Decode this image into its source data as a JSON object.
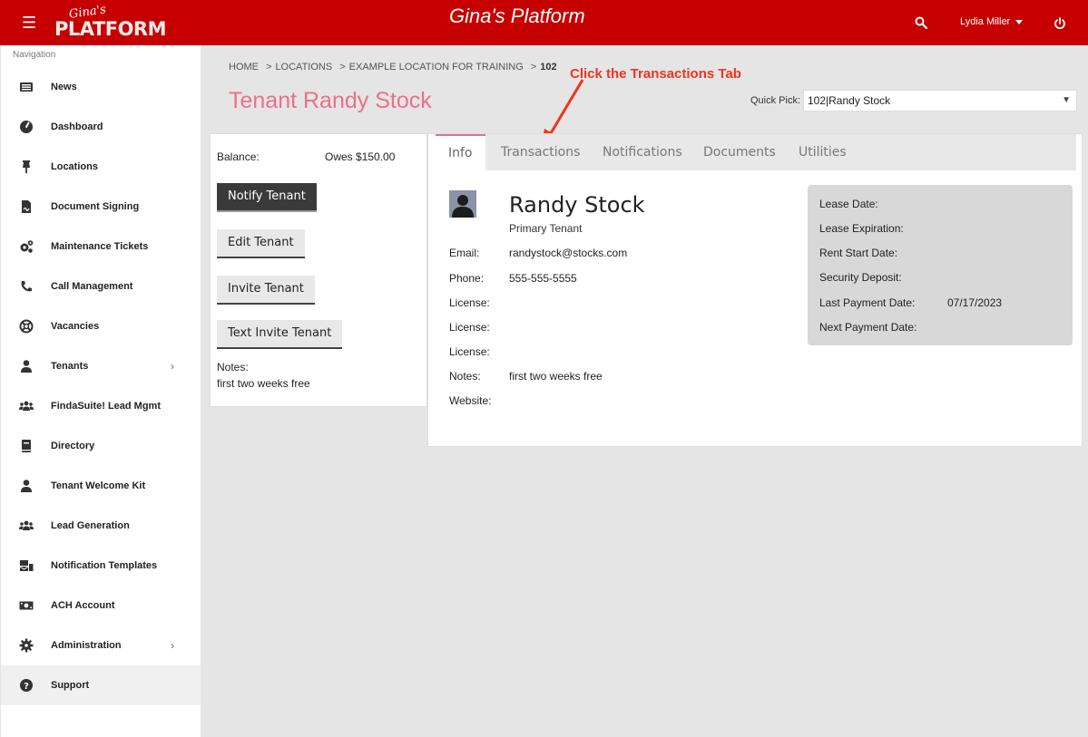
{
  "header": {
    "logo_script": "Gina's",
    "logo_main": "PLATFORM",
    "title": "Gina's Platform",
    "user_name": "Lydia Miller",
    "icons": {
      "menu": "hamburger-icon",
      "search": "search-icon",
      "power": "power-icon",
      "dropdown": "caret-down-icon"
    }
  },
  "sidebar": {
    "heading": "Navigation",
    "items": [
      {
        "label": "News",
        "icon": "newspaper-icon"
      },
      {
        "label": "Dashboard",
        "icon": "gauge-icon"
      },
      {
        "label": "Locations",
        "icon": "pushpin-icon"
      },
      {
        "label": "Document Signing",
        "icon": "file-signature-icon"
      },
      {
        "label": "Maintenance Tickets",
        "icon": "cogs-icon"
      },
      {
        "label": "Call Management",
        "icon": "phone-icon"
      },
      {
        "label": "Vacancies",
        "icon": "life-ring-icon"
      },
      {
        "label": "Tenants",
        "icon": "user-icon",
        "chevron": "›"
      },
      {
        "label": "FindaSuite! Lead Mgmt",
        "icon": "users-icon"
      },
      {
        "label": "Directory",
        "icon": "book-icon"
      },
      {
        "label": "Tenant Welcome Kit",
        "icon": "user-icon"
      },
      {
        "label": "Lead Generation",
        "icon": "users-icon"
      },
      {
        "label": "Notification Templates",
        "icon": "mail-bulk-icon"
      },
      {
        "label": "ACH Account",
        "icon": "money-bill-icon"
      },
      {
        "label": "Administration",
        "icon": "gear-icon",
        "chevron": "›"
      },
      {
        "label": "Support",
        "icon": "question-circle-icon"
      }
    ]
  },
  "breadcrumb": [
    {
      "label": "HOME"
    },
    {
      "sep": ">",
      "label": "LOCATIONS"
    },
    {
      "sep": ">",
      "label": "EXAMPLE LOCATION FOR TRAINING"
    },
    {
      "sep": ">",
      "label": "102"
    }
  ],
  "page": {
    "title": "Tenant Randy Stock",
    "annotation": "Click the Transactions Tab"
  },
  "quick_pick": {
    "label": "Quick Pick:",
    "value": "102|Randy Stock",
    "arrow": "▼"
  },
  "left_card": {
    "balance_label": "Balance:",
    "balance_value": "Owes $150.00",
    "buttons": {
      "notify": "Notify Tenant",
      "edit": "Edit Tenant",
      "invite": "Invite Tenant",
      "text_invite": "Text Invite Tenant"
    },
    "notes_label": "Notes:",
    "notes_value": "first two weeks free"
  },
  "tabs": [
    {
      "label": "Info",
      "active": true
    },
    {
      "label": "Transactions"
    },
    {
      "label": "Notifications"
    },
    {
      "label": "Documents"
    },
    {
      "label": "Utilities"
    }
  ],
  "tenant": {
    "name": "Randy Stock",
    "role": "Primary Tenant",
    "fields": [
      {
        "label": "Email:",
        "value": "randystock@stocks.com"
      },
      {
        "label": "Phone:",
        "value": "555-555-5555"
      },
      {
        "label": "License:",
        "value": ""
      },
      {
        "label": "License:",
        "value": ""
      },
      {
        "label": "License:",
        "value": ""
      },
      {
        "label": "Notes:",
        "value": "first two weeks free"
      },
      {
        "label": "Website:",
        "value": ""
      }
    ]
  },
  "lease": [
    {
      "label": "Lease Date:",
      "value": ""
    },
    {
      "label": "Lease Expiration:",
      "value": ""
    },
    {
      "label": "Rent Start Date:",
      "value": ""
    },
    {
      "label": "Security Deposit:",
      "value": ""
    },
    {
      "label": "Last Payment Date:",
      "value": "07/17/2023"
    },
    {
      "label": "Next Payment Date:",
      "value": ""
    }
  ]
}
